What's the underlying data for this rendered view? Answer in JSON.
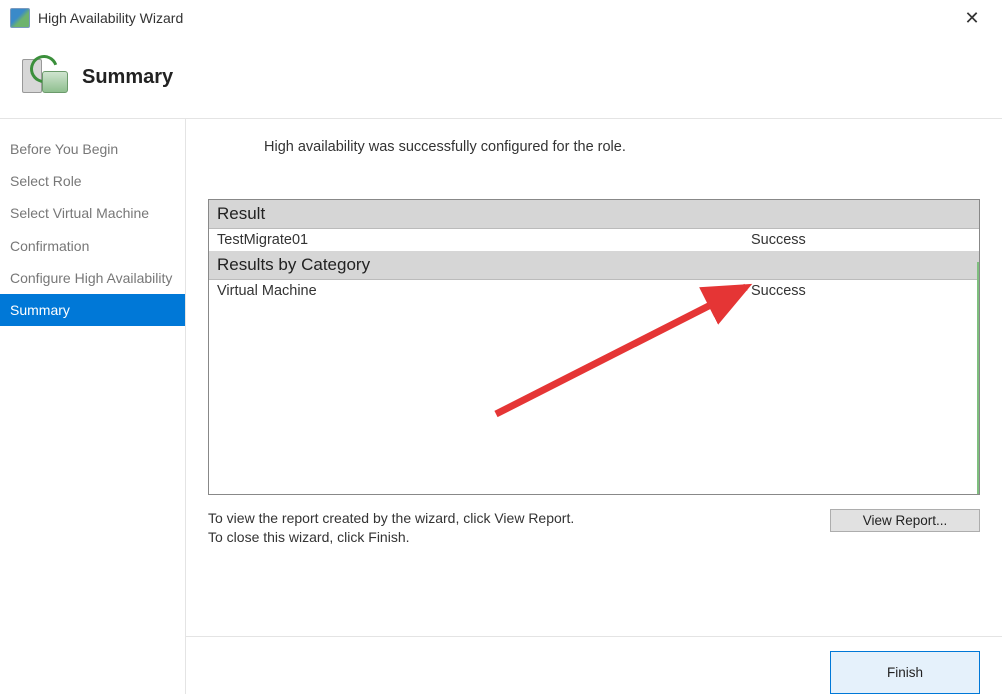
{
  "window": {
    "title": "High Availability Wizard",
    "close_glyph": "✕"
  },
  "header": {
    "page_title": "Summary"
  },
  "sidebar": {
    "steps": [
      {
        "label": "Before You Begin",
        "selected": false
      },
      {
        "label": "Select Role",
        "selected": false
      },
      {
        "label": "Select Virtual Machine",
        "selected": false
      },
      {
        "label": "Confirmation",
        "selected": false
      },
      {
        "label": "Configure High Availability",
        "selected": false
      },
      {
        "label": "Summary",
        "selected": true
      }
    ]
  },
  "main": {
    "status_message": "High availability was successfully configured for the role.",
    "result_header": "Result",
    "result_rows": [
      {
        "name": "TestMigrate01",
        "status": "Success"
      }
    ],
    "category_header": "Results by Category",
    "category_rows": [
      {
        "name": "Virtual Machine",
        "status": "Success"
      }
    ],
    "hint_line1": "To view the report created by the wizard, click View Report.",
    "hint_line2": "To close this wizard, click Finish.",
    "view_report_label": "View Report...",
    "finish_label": "Finish"
  },
  "annotation": {
    "arrow_color": "#e53535"
  }
}
